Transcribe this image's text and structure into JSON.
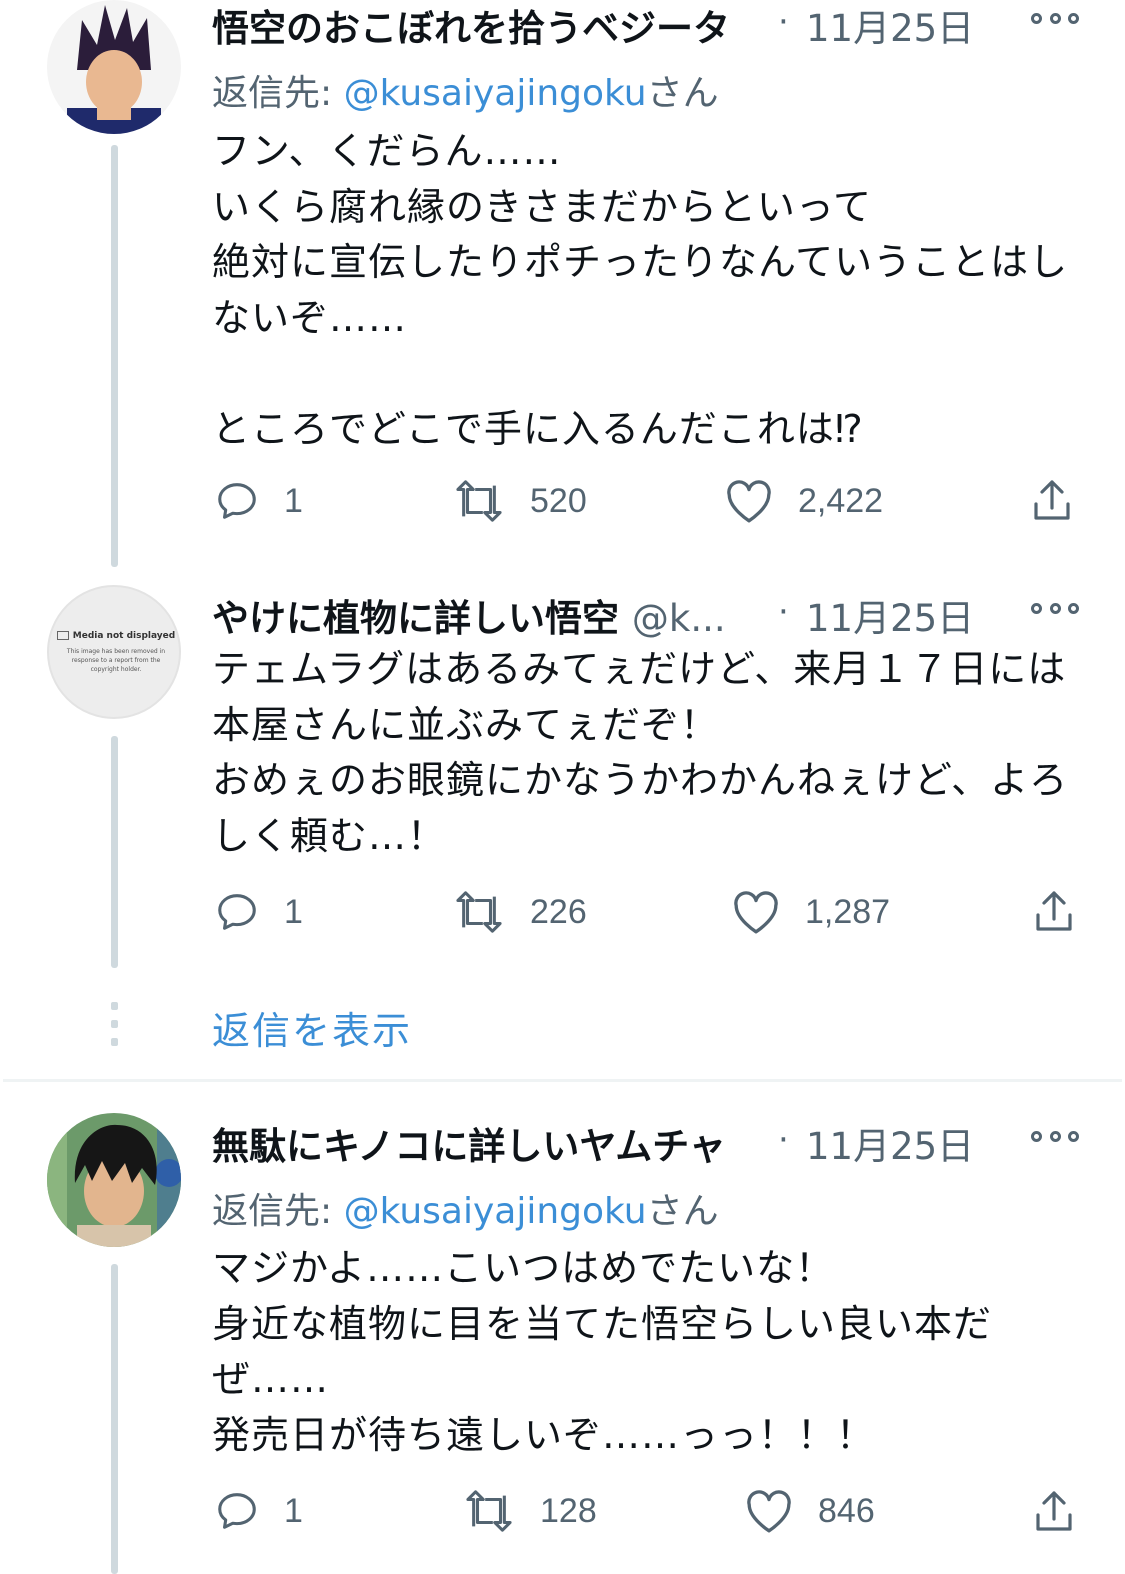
{
  "tweets": [
    {
      "name": "悟空のおこぼれを拾うベジータ",
      "handle": "",
      "date": "11月25日",
      "reply_prefix": "返信先: ",
      "reply_handle": "@kusaiyajingoku",
      "reply_suffix": "さん",
      "body": "フン、くだらん……\nいくら腐れ縁のきさまだからといって\n絶対に宣伝したりポチったりなんていうことはし\nないぞ……\n\nところでどこで手に入るんだこれは⁉",
      "replies": "1",
      "retweets": "520",
      "likes": "2,422"
    },
    {
      "name": "やけに植物に詳しい悟空",
      "handle": "@k...",
      "date": "11月25日",
      "media_title": "Media not displayed",
      "media_note": "This image has been removed in response to a report from the copyright holder.",
      "body": "テェムラグはあるみてぇだけど、来月１７日には\n本屋さんに並ぶみてぇだぞ！\nおめぇのお眼鏡にかなうかわかんねぇけど、よろ\nしく頼む…！",
      "replies": "1",
      "retweets": "226",
      "likes": "1,287"
    },
    {
      "name": "無駄にキノコに詳しいヤムチャ",
      "handle": "",
      "date": "11月25日",
      "reply_prefix": "返信先: ",
      "reply_handle": "@kusaiyajingoku",
      "reply_suffix": "さん",
      "body": "マジかよ……こいつはめでたいな！\n身近な植物に目を当てた悟空らしい良い本だ\nぜ……\n発売日が待ち遠しいぞ……っっ！！！",
      "replies": "1",
      "retweets": "128",
      "likes": "846"
    }
  ],
  "show_replies": "返信を表示",
  "dot_sep": "·",
  "icons": [
    "reply-icon",
    "retweet-icon",
    "like-icon",
    "share-icon",
    "more-icon"
  ]
}
